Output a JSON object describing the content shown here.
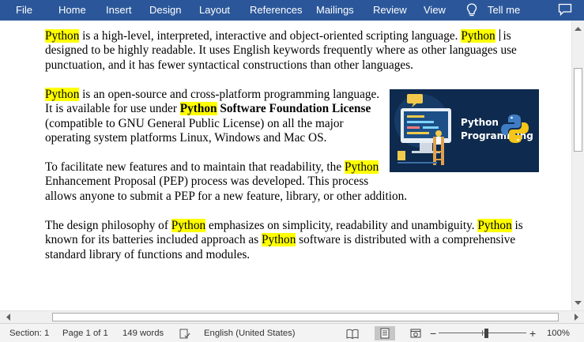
{
  "ribbon": {
    "tabs": [
      "File",
      "Home",
      "Insert",
      "Design",
      "Layout",
      "References",
      "Mailings",
      "Review",
      "View"
    ],
    "tell_me": "Tell me"
  },
  "document": {
    "highlight_color": "#ffff00",
    "p1": {
      "w1": "Python",
      "t1": " is a high-level, interpreted, interactive and object-oriented scripting language. ",
      "w2": "Python",
      "t2": " is designed to be highly readable. It uses English keywords frequently where as other languages use punctuation, and it has fewer syntactical constructions than other languages."
    },
    "p2": {
      "w1": "Python",
      "t1": " is an open-source and cross-platform programming language. It is available for use under ",
      "w2": "Python",
      "b1": " Software Foundation License",
      "t2": " (compatible to GNU General Public License) on all the major operating system platforms Linux, Windows and Mac OS."
    },
    "image": {
      "title_line1": "Python",
      "title_line2": "Programming",
      "background": "#0e2a4e"
    },
    "p3": {
      "t1": "To facilitate new features and to maintain that readability, the ",
      "w1": "Python",
      "t2": " Enhancement Proposal (PEP) process was developed. This process allows anyone to submit a PEP for a new feature, library, or other addition."
    },
    "p4": {
      "t1": "The design philosophy of ",
      "w1": "Python",
      "t2": " emphasizes on simplicity, readability and unambiguity. ",
      "w2": "Python",
      "t3": " is known for its batteries included approach as ",
      "w3": "Python",
      "t4": " software is distributed with a comprehensive standard library of functions and modules."
    }
  },
  "status": {
    "section": "Section: 1",
    "page": "Page 1 of 1",
    "words": "149 words",
    "language": "English (United States)",
    "zoom_minus": "−",
    "zoom_plus": "+",
    "zoom": "100%",
    "zoom_value_percent": 100
  },
  "colors": {
    "ribbon": "#2b579a",
    "status_bar": "#f3f3f3"
  }
}
